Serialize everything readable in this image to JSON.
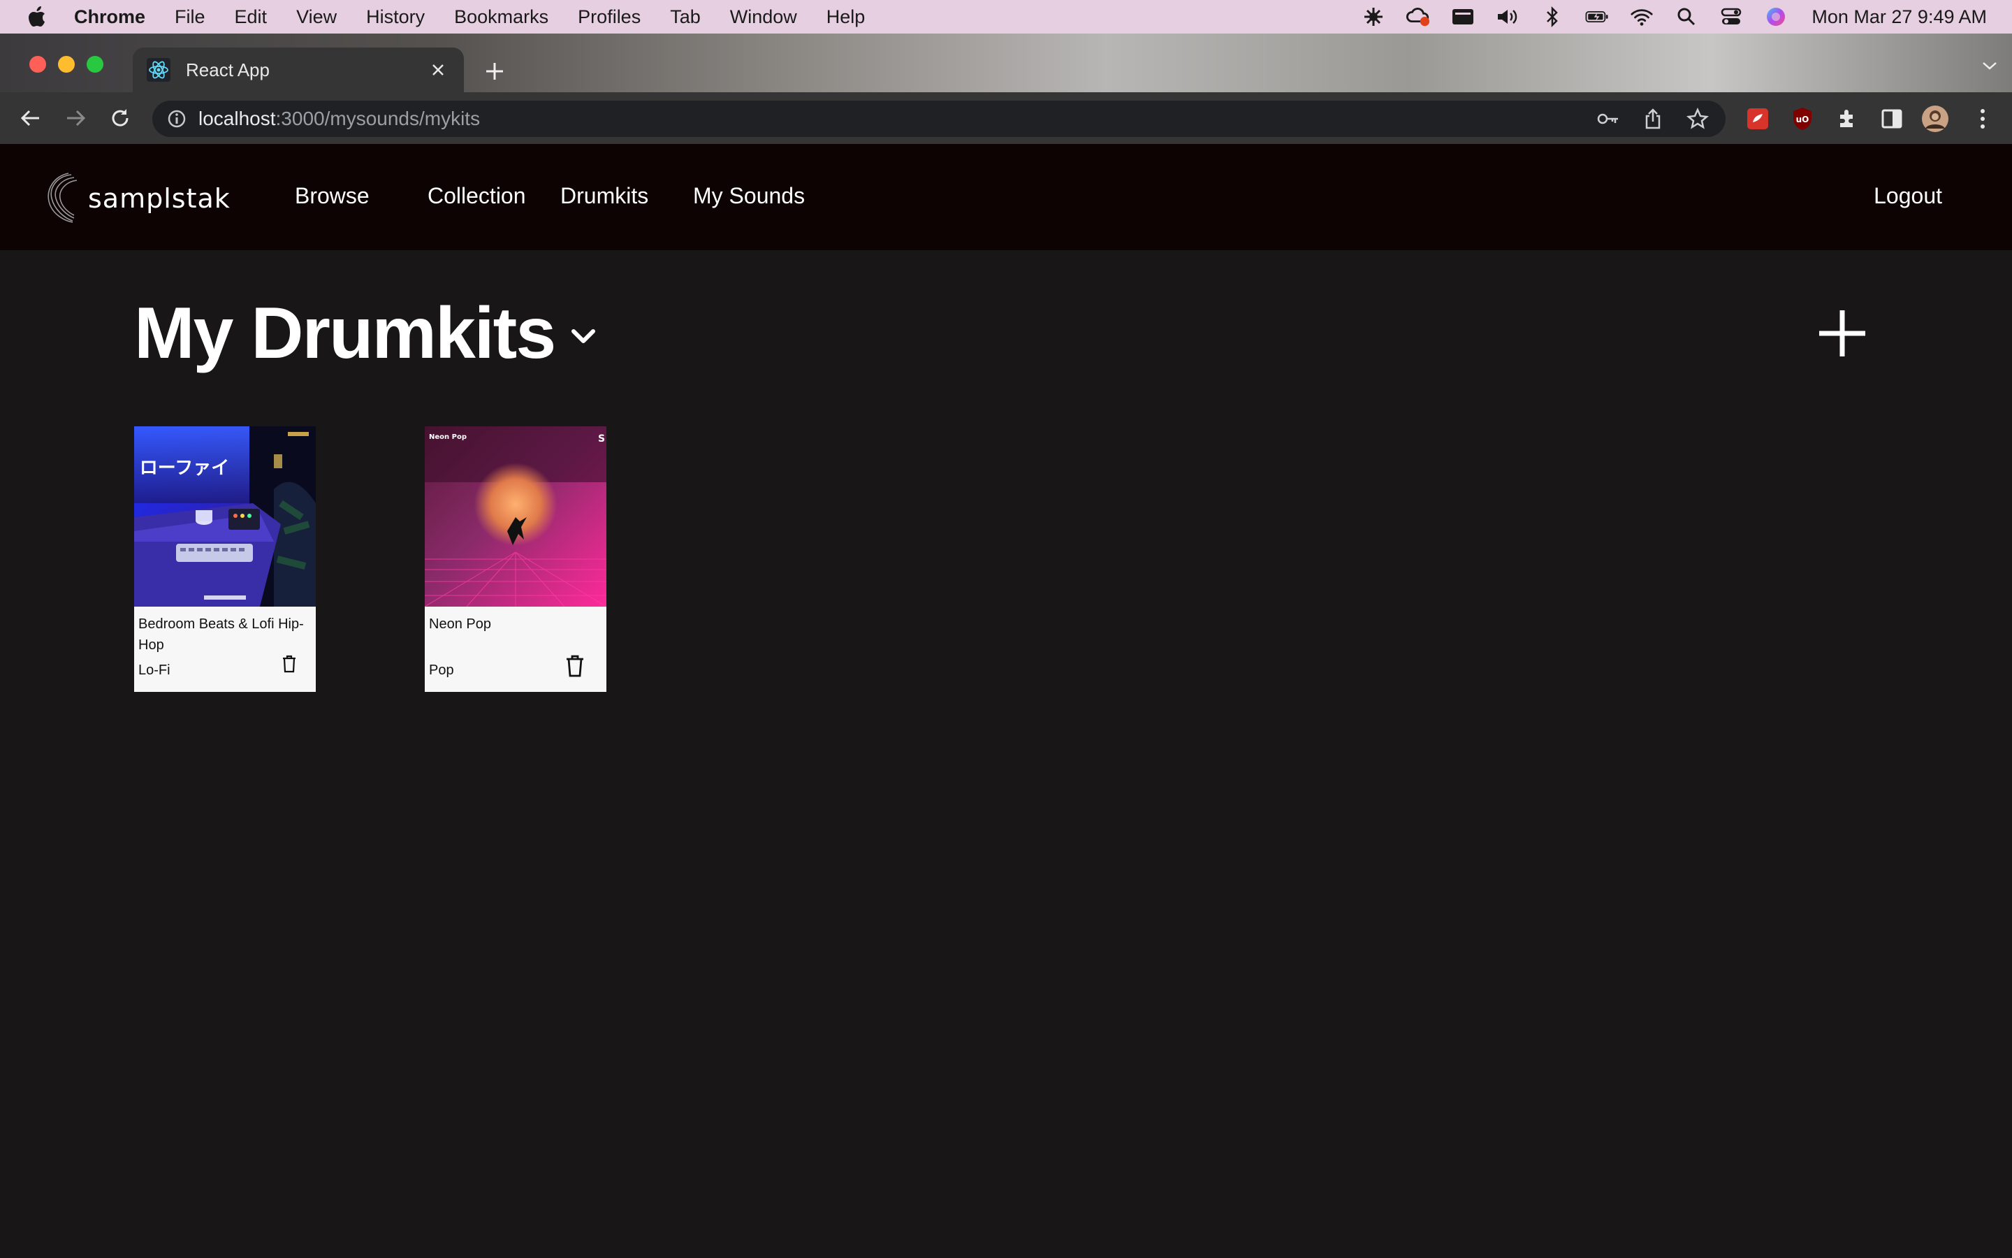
{
  "menubar": {
    "app_name": "Chrome",
    "items": [
      "File",
      "Edit",
      "View",
      "History",
      "Bookmarks",
      "Profiles",
      "Tab",
      "Window",
      "Help"
    ],
    "clock": "Mon Mar 27  9:49 AM"
  },
  "browser": {
    "tab_title": "React App",
    "url_host": "localhost",
    "url_path": ":3000/mysounds/mykits"
  },
  "header": {
    "logo_text": "samplstak",
    "nav": [
      "Browse",
      "Collection",
      "Drumkits",
      "My Sounds"
    ],
    "logout_label": "Logout"
  },
  "main": {
    "title": "My Drumkits",
    "kits": [
      {
        "name": "Bedroom Beats & Lofi Hip-Hop",
        "genre": "Lo-Fi",
        "cover_text": "ローファイ"
      },
      {
        "name": "Neon Pop",
        "genre": "Pop",
        "cover_text": "Neon Pop"
      }
    ]
  },
  "colors": {
    "page_bg": "#181616",
    "header_bg": "#0d0303",
    "card_bg": "#f7f7f7",
    "menubar_bg": "#e6cfe0"
  }
}
